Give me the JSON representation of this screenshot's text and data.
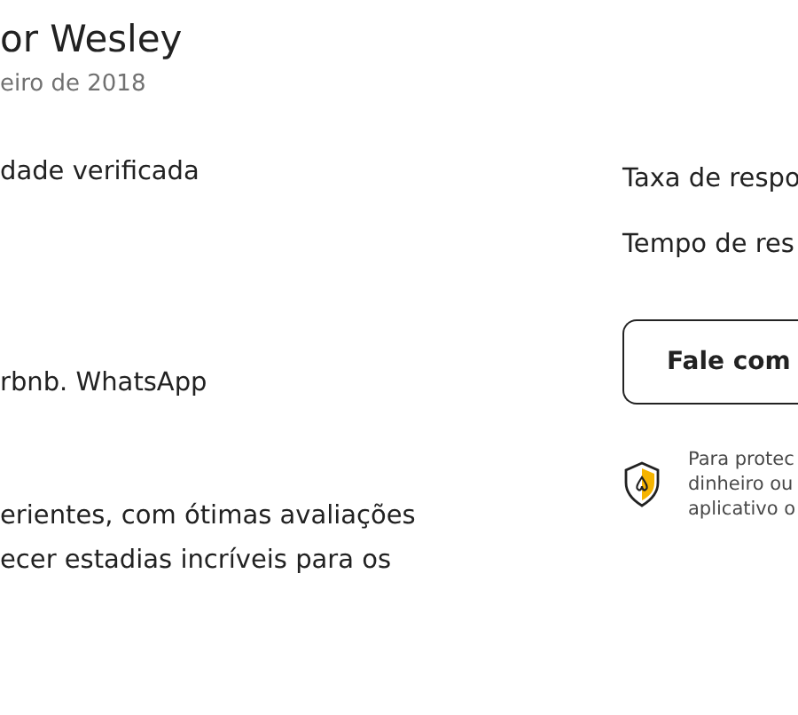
{
  "host": {
    "title": "or Wesley",
    "since": "eiro de 2018"
  },
  "badges": [
    "dade verificada"
  ],
  "note": "rbnb. WhatsApp",
  "description": [
    "erientes, com ótimas avaliações",
    "ecer estadias incríveis para os"
  ],
  "stats": [
    "Taxa de respo",
    "Tempo de res"
  ],
  "contact_button": "Fale com",
  "safety_notice": [
    "Para protec",
    "dinheiro ou",
    "aplicativo o"
  ]
}
